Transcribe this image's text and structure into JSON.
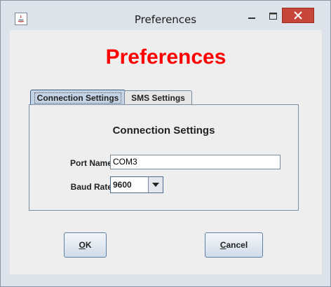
{
  "window": {
    "title": "Preferences",
    "controls": {
      "minimize": "—",
      "maximize": "□",
      "close": "✕"
    },
    "close_color": "#c7463a"
  },
  "header": {
    "title": "Preferences",
    "color": "#ff0000"
  },
  "tabs": [
    {
      "label": "Connection Settings",
      "active": true
    },
    {
      "label": "SMS Settings",
      "active": false
    }
  ],
  "connection": {
    "section_title": "Connection Settings",
    "port_label": "Port Name:",
    "port_value": "COM3",
    "baud_label": "Baud Rate:",
    "baud_value": "9600"
  },
  "buttons": {
    "ok_first": "O",
    "ok_rest": "K",
    "cancel_first": "C",
    "cancel_rest": "ancel"
  }
}
